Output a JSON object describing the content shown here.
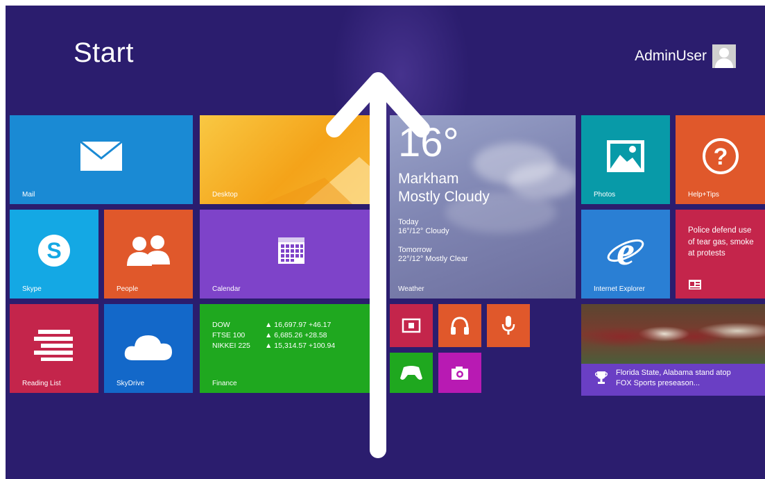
{
  "header": {
    "title": "Start",
    "username": "AdminUser"
  },
  "tiles": {
    "mail": {
      "label": "Mail",
      "color": "#1a8ad4"
    },
    "desktop": {
      "label": "Desktop",
      "color": "#f6b91a"
    },
    "weather": {
      "label": "Weather",
      "temperature": "16°",
      "city": "Markham",
      "condition": "Mostly Cloudy",
      "today_label": "Today",
      "today_forecast": "16°/12° Cloudy",
      "tomorrow_label": "Tomorrow",
      "tomorrow_forecast": "22°/12° Mostly Clear"
    },
    "photos": {
      "label": "Photos",
      "color": "#089aa8"
    },
    "help": {
      "label": "Help+Tips",
      "color": "#e0582b"
    },
    "skype": {
      "label": "Skype",
      "color": "#14a8e4"
    },
    "people": {
      "label": "People",
      "color": "#e0582b"
    },
    "calendar": {
      "label": "Calendar",
      "color": "#7e43c9"
    },
    "ie": {
      "label": "Internet Explorer",
      "color": "#2a7fd4"
    },
    "news": {
      "headline": "Police defend use of tear gas, smoke at protests",
      "color": "#c4254b"
    },
    "reading_list": {
      "label": "Reading List",
      "color": "#c4254b"
    },
    "skydrive": {
      "label": "SkyDrive",
      "color": "#1368c9"
    },
    "finance": {
      "label": "Finance",
      "color": "#1fa81f",
      "rows": [
        {
          "name": "DOW",
          "value": "▲ 16,697.97 +46.17"
        },
        {
          "name": "FTSE 100",
          "value": "▲ 6,685.26 +28.58"
        },
        {
          "name": "NIKKEI 225",
          "value": "▲ 15,314.57 +100.94"
        }
      ]
    },
    "small": {
      "video_color": "#c4254b",
      "music_color": "#e0582b",
      "voice_color": "#e0582b",
      "games_color": "#1fa81f",
      "camera_color": "#b81ab3"
    },
    "sports": {
      "headline": "Florida State, Alabama stand atop FOX Sports preseason..."
    }
  },
  "colors": {
    "background": "#2b1d6e",
    "arrow": "#ffffff"
  }
}
